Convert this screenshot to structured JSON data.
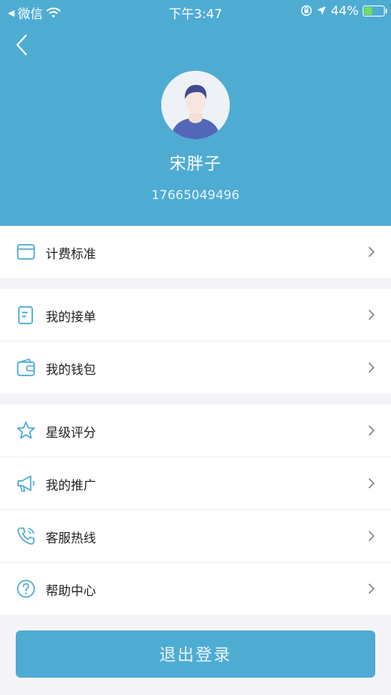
{
  "status_bar": {
    "carrier": "微信",
    "time": "下午3:47",
    "battery": "44%",
    "battery_level": 0.44
  },
  "profile": {
    "name": "宋胖子",
    "phone": "17665049496"
  },
  "menu": {
    "pricing": "计费标准",
    "my_orders": "我的接单",
    "my_wallet": "我的钱包",
    "star_rating": "星级评分",
    "my_promotion": "我的推广",
    "service_hotline": "客服热线",
    "help_center": "帮助中心"
  },
  "logout_label": "退出登录",
  "colors": {
    "primary": "#4eacd3",
    "background": "#f4f4f8",
    "icon": "#4eacd3"
  }
}
